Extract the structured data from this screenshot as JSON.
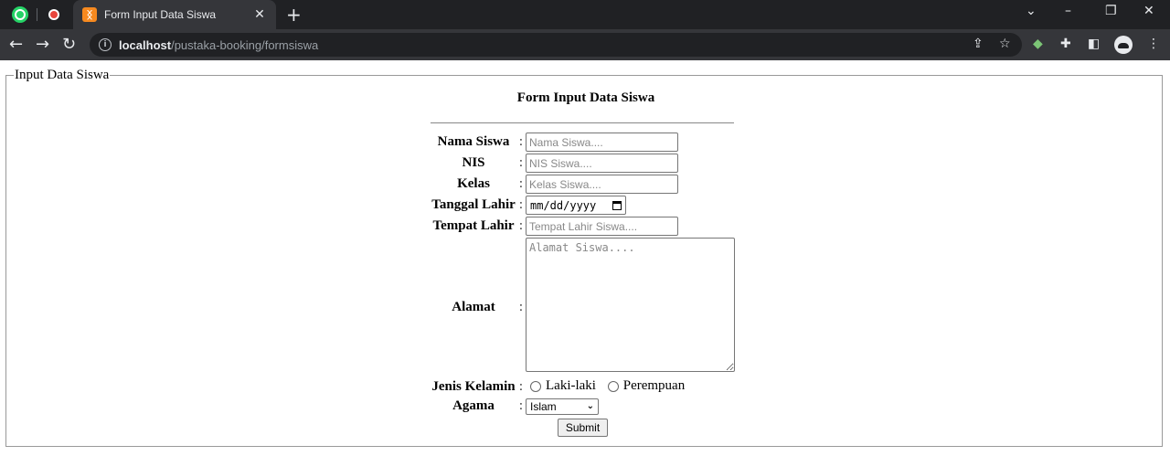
{
  "browser": {
    "tab_title": "Form Input Data Siswa",
    "url_host": "localhost",
    "url_path": "/pustaka-booking/formsiswa",
    "new_tab_symbol": "+"
  },
  "page": {
    "legend": "Input Data Siswa",
    "form_title": "Form Input Data Siswa",
    "colon": ":",
    "fields": {
      "nama": {
        "label": "Nama Siswa",
        "placeholder": "Nama Siswa...."
      },
      "nis": {
        "label": "NIS",
        "placeholder": "NIS Siswa...."
      },
      "kelas": {
        "label": "Kelas",
        "placeholder": "Kelas Siswa...."
      },
      "tanggal": {
        "label": "Tanggal Lahir",
        "value": "mm/dd/yyyy"
      },
      "tempat": {
        "label": "Tempat Lahir",
        "placeholder": "Tempat Lahir Siswa...."
      },
      "alamat": {
        "label": "Alamat",
        "placeholder": "Alamat Siswa...."
      },
      "jk": {
        "label": "Jenis Kelamin",
        "options": [
          "Laki-laki",
          "Perempuan"
        ]
      },
      "agama": {
        "label": "Agama",
        "selected": "Islam"
      }
    },
    "submit_label": "Submit"
  }
}
